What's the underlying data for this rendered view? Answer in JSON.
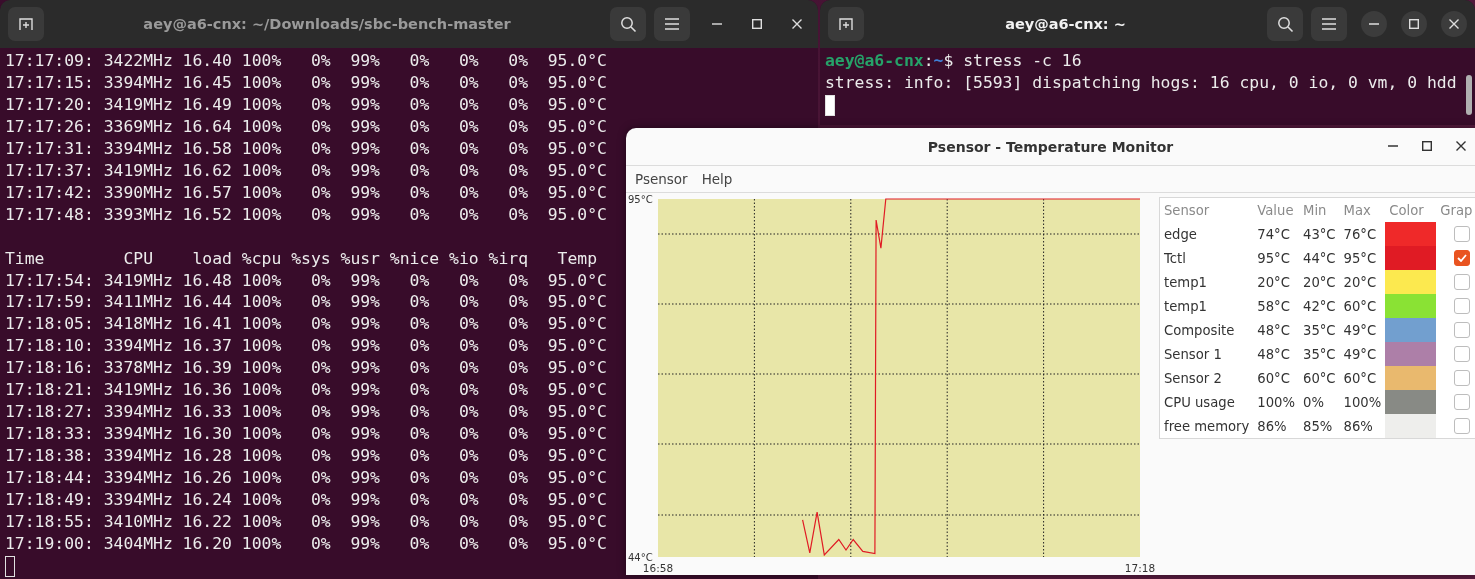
{
  "terminals": [
    {
      "title": "aey@a6-cnx: ~/Downloads/sbc-bench-master",
      "focused": false,
      "lines": [
        {
          "kind": "output",
          "text": "17:17:09: 3422MHz 16.40 100%   0%  99%   0%   0%   0%  95.0°C"
        },
        {
          "kind": "output",
          "text": "17:17:15: 3394MHz 16.45 100%   0%  99%   0%   0%   0%  95.0°C"
        },
        {
          "kind": "output",
          "text": "17:17:20: 3419MHz 16.49 100%   0%  99%   0%   0%   0%  95.0°C"
        },
        {
          "kind": "output",
          "text": "17:17:26: 3369MHz 16.64 100%   0%  99%   0%   0%   0%  95.0°C"
        },
        {
          "kind": "output",
          "text": "17:17:31: 3394MHz 16.58 100%   0%  99%   0%   0%   0%  95.0°C"
        },
        {
          "kind": "output",
          "text": "17:17:37: 3419MHz 16.62 100%   0%  99%   0%   0%   0%  95.0°C"
        },
        {
          "kind": "output",
          "text": "17:17:42: 3390MHz 16.57 100%   0%  99%   0%   0%   0%  95.0°C"
        },
        {
          "kind": "output",
          "text": "17:17:48: 3393MHz 16.52 100%   0%  99%   0%   0%   0%  95.0°C"
        },
        {
          "kind": "blank"
        },
        {
          "kind": "output",
          "text": "Time        CPU    load %cpu %sys %usr %nice %io %irq   Temp"
        },
        {
          "kind": "output",
          "text": "17:17:54: 3419MHz 16.48 100%   0%  99%   0%   0%   0%  95.0°C"
        },
        {
          "kind": "output",
          "text": "17:17:59: 3411MHz 16.44 100%   0%  99%   0%   0%   0%  95.0°C"
        },
        {
          "kind": "output",
          "text": "17:18:05: 3418MHz 16.41 100%   0%  99%   0%   0%   0%  95.0°C"
        },
        {
          "kind": "output",
          "text": "17:18:10: 3394MHz 16.37 100%   0%  99%   0%   0%   0%  95.0°C"
        },
        {
          "kind": "output",
          "text": "17:18:16: 3378MHz 16.39 100%   0%  99%   0%   0%   0%  95.0°C"
        },
        {
          "kind": "output",
          "text": "17:18:21: 3419MHz 16.36 100%   0%  99%   0%   0%   0%  95.0°C"
        },
        {
          "kind": "output",
          "text": "17:18:27: 3394MHz 16.33 100%   0%  99%   0%   0%   0%  95.0°C"
        },
        {
          "kind": "output",
          "text": "17:18:33: 3394MHz 16.30 100%   0%  99%   0%   0%   0%  95.0°C"
        },
        {
          "kind": "output",
          "text": "17:18:38: 3394MHz 16.28 100%   0%  99%   0%   0%   0%  95.0°C"
        },
        {
          "kind": "output",
          "text": "17:18:44: 3394MHz 16.26 100%   0%  99%   0%   0%   0%  95.0°C"
        },
        {
          "kind": "output",
          "text": "17:18:49: 3394MHz 16.24 100%   0%  99%   0%   0%   0%  95.0°C"
        },
        {
          "kind": "output",
          "text": "17:18:55: 3410MHz 16.22 100%   0%  99%   0%   0%   0%  95.0°C"
        },
        {
          "kind": "output",
          "text": "17:19:00: 3404MHz 16.20 100%   0%  99%   0%   0%   0%  95.0°C"
        }
      ]
    },
    {
      "title": "aey@a6-cnx: ~",
      "focused": true,
      "lines": [
        {
          "kind": "prompt",
          "segments": [
            {
              "text": "aey@a6-cnx",
              "kind": "user"
            },
            {
              "text": ":",
              "kind": "plain"
            },
            {
              "text": "~",
              "kind": "path"
            },
            {
              "text": "$ stress -c 16",
              "kind": "plain"
            }
          ]
        },
        {
          "kind": "output",
          "text": "stress: info: [5593] dispatching hogs: 16 cpu, 0 io, 0 vm, 0 hdd"
        }
      ]
    }
  ],
  "psensor": {
    "title": "Psensor - Temperature Monitor",
    "menu": [
      "Psensor",
      "Help"
    ],
    "graph": {
      "chart_data": {
        "type": "line",
        "x": [
          17.0667,
          17.0717,
          17.0767,
          17.0817,
          17.0917,
          17.0967,
          17.1017,
          17.1083,
          17.1167,
          17.1175,
          17.1208,
          17.1242,
          17.3
        ],
        "series": [
          {
            "color": "#e01b24",
            "values": [
              49.3,
              44.6,
              50.4,
              44.3,
              46.5,
              45.0,
              46.5,
              44.8,
              44.5,
              92.0,
              88.0,
              95.0,
              95.0
            ]
          }
        ],
        "xlim": [
          16.9667,
          17.3
        ],
        "ylim": [
          44,
          95
        ],
        "xticks": [
          {
            "value": 16.9667,
            "label": "16:58"
          },
          {
            "value": 17.3,
            "label": "17:18"
          }
        ],
        "yticks": [
          {
            "value": 44,
            "label": "44°C"
          },
          {
            "value": 95,
            "label": "95°C"
          }
        ]
      }
    },
    "sensor_table": {
      "columns": [
        "Sensor",
        "Value",
        "Min",
        "Max",
        "Color",
        "Grap"
      ],
      "rows": [
        {
          "sensor": "edge",
          "value": "74°C",
          "min": "43°C",
          "max": "76°C",
          "color": "#ef2929",
          "graph": false
        },
        {
          "sensor": "Tctl",
          "value": "95°C",
          "min": "44°C",
          "max": "95°C",
          "color": "#e01b24",
          "graph": true
        },
        {
          "sensor": "temp1",
          "value": "20°C",
          "min": "20°C",
          "max": "20°C",
          "color": "#fce94f",
          "graph": false
        },
        {
          "sensor": "temp1",
          "value": "58°C",
          "min": "42°C",
          "max": "60°C",
          "color": "#8ae234",
          "graph": false
        },
        {
          "sensor": "Composite",
          "value": "48°C",
          "min": "35°C",
          "max": "49°C",
          "color": "#729fcf",
          "graph": false
        },
        {
          "sensor": "Sensor 1",
          "value": "48°C",
          "min": "35°C",
          "max": "49°C",
          "color": "#ad7fa8",
          "graph": false
        },
        {
          "sensor": "Sensor 2",
          "value": "60°C",
          "min": "60°C",
          "max": "60°C",
          "color": "#e9b96e",
          "graph": false
        },
        {
          "sensor": "CPU usage",
          "value": "100%",
          "min": "0%",
          "max": "100%",
          "color": "#888a85",
          "graph": false
        },
        {
          "sensor": "free memory",
          "value": "86%",
          "min": "85%",
          "max": "86%",
          "color": "#eeeeec",
          "graph": false
        }
      ]
    }
  }
}
